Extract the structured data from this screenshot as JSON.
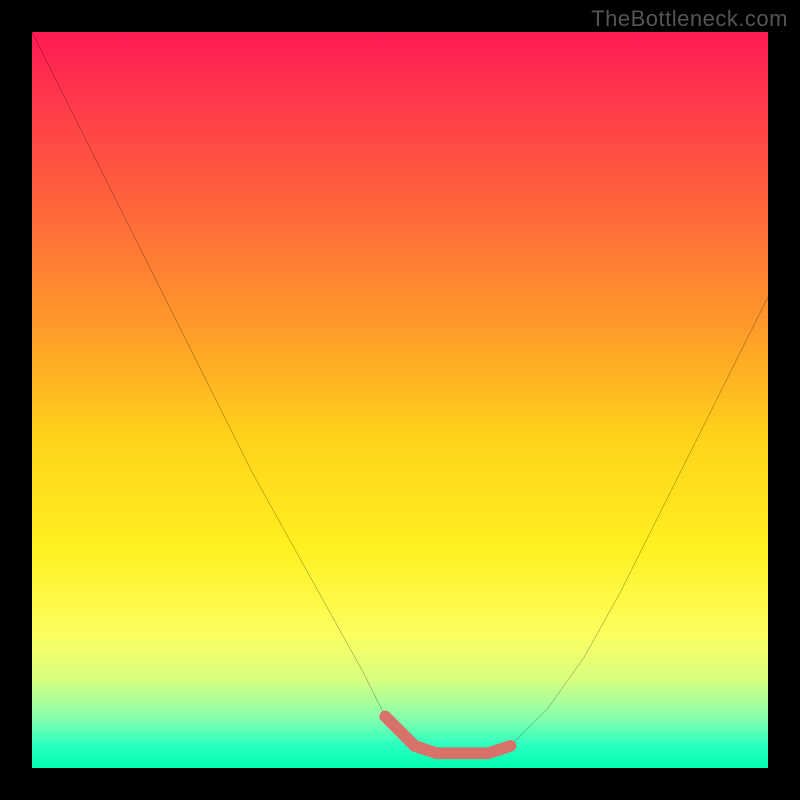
{
  "watermark": "TheBottleneck.com",
  "chart_data": {
    "type": "line",
    "title": "",
    "xlabel": "",
    "ylabel": "",
    "xlim": [
      0,
      100
    ],
    "ylim": [
      0,
      100
    ],
    "gradient_stops": [
      {
        "pct": 0,
        "color": "#ff1a55"
      },
      {
        "pct": 10,
        "color": "#ff3a4a"
      },
      {
        "pct": 25,
        "color": "#ff6a3a"
      },
      {
        "pct": 40,
        "color": "#ff9a2a"
      },
      {
        "pct": 55,
        "color": "#ffd21a"
      },
      {
        "pct": 70,
        "color": "#fff020"
      },
      {
        "pct": 82,
        "color": "#fcff60"
      },
      {
        "pct": 88,
        "color": "#d8ff80"
      },
      {
        "pct": 93,
        "color": "#8affaa"
      },
      {
        "pct": 97,
        "color": "#2affc0"
      },
      {
        "pct": 100,
        "color": "#00ffb0"
      }
    ],
    "series": [
      {
        "name": "curve",
        "color": "#000000",
        "x": [
          0,
          5,
          10,
          15,
          20,
          25,
          30,
          35,
          40,
          45,
          48,
          50,
          52,
          55,
          58,
          60,
          62,
          65,
          70,
          75,
          80,
          85,
          90,
          95,
          100
        ],
        "y": [
          100,
          90,
          80,
          70,
          60,
          50,
          40,
          31,
          22,
          13,
          7,
          5,
          3,
          2,
          2,
          2,
          2,
          3,
          8,
          15,
          24,
          34,
          44,
          54,
          64
        ]
      },
      {
        "name": "highlight-band",
        "color": "#d9716b",
        "x": [
          48,
          50,
          52,
          55,
          58,
          60,
          62,
          65
        ],
        "y": [
          7,
          5,
          3,
          2,
          2,
          2,
          2,
          3
        ]
      }
    ]
  }
}
